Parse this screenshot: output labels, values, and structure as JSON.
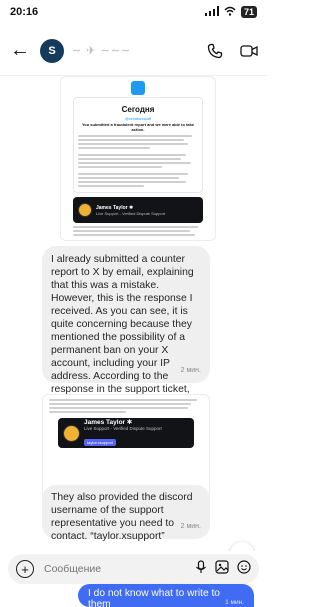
{
  "status": {
    "time": "20:16",
    "battery": "71"
  },
  "header": {
    "contact_name": "∼ ✈ ∼∼∼",
    "avatar_initial": "S"
  },
  "screenshot1": {
    "heading": "Сегодня",
    "handle": "@creatorsstaff",
    "subtitle": "You submitted a fraudulent report and we were able to take action."
  },
  "screenshot2": {
    "discord_name": "James Taylor ✱",
    "discord_role": "Live Support - Verified Dispute Support",
    "discord_button": "taylor.xsupport"
  },
  "messages": [
    {
      "text": "I already submitted a counter report to X by email, explaining that this was a mistake. However, this is the response I received. As you can see, it is quite concerning because they mentioned the possibility of a permanent ban on your X account, including your IP address. According to the response in the support ticket, however, the issue can still be resolved by following the instructions they provided.",
      "time": "2 мин."
    },
    {
      "text": "They also provided the discord username of the support representative you need to contact. “taylor.xsupport”",
      "time": "2 мин."
    }
  ],
  "composer": {
    "placeholder": "Сообщение"
  },
  "outgoing": {
    "text": "I do not know what to write to them",
    "time": "1 мин."
  }
}
